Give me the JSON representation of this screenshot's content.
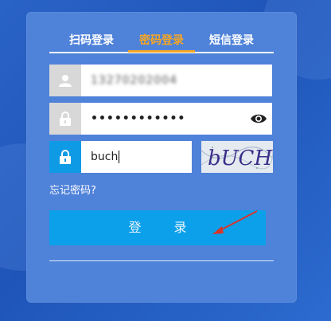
{
  "tabs": [
    {
      "label": "扫码登录",
      "active": false
    },
    {
      "label": "密码登录",
      "active": true
    },
    {
      "label": "短信登录",
      "active": false
    }
  ],
  "username": {
    "value": "13270202004",
    "icon": "user-icon"
  },
  "password": {
    "value": "••••••••••••",
    "icon": "lock-icon",
    "toggle_icon": "eye-icon"
  },
  "captcha": {
    "value": "buch",
    "icon": "lock-icon",
    "image_text": "bUCH"
  },
  "forgot_link": "忘记密码?",
  "login_button": "登 录",
  "colors": {
    "panel": "#4f82d9",
    "active_tab": "#f5a623",
    "button": "#0ca0ea",
    "annotation_arrow": "#d9342b"
  }
}
